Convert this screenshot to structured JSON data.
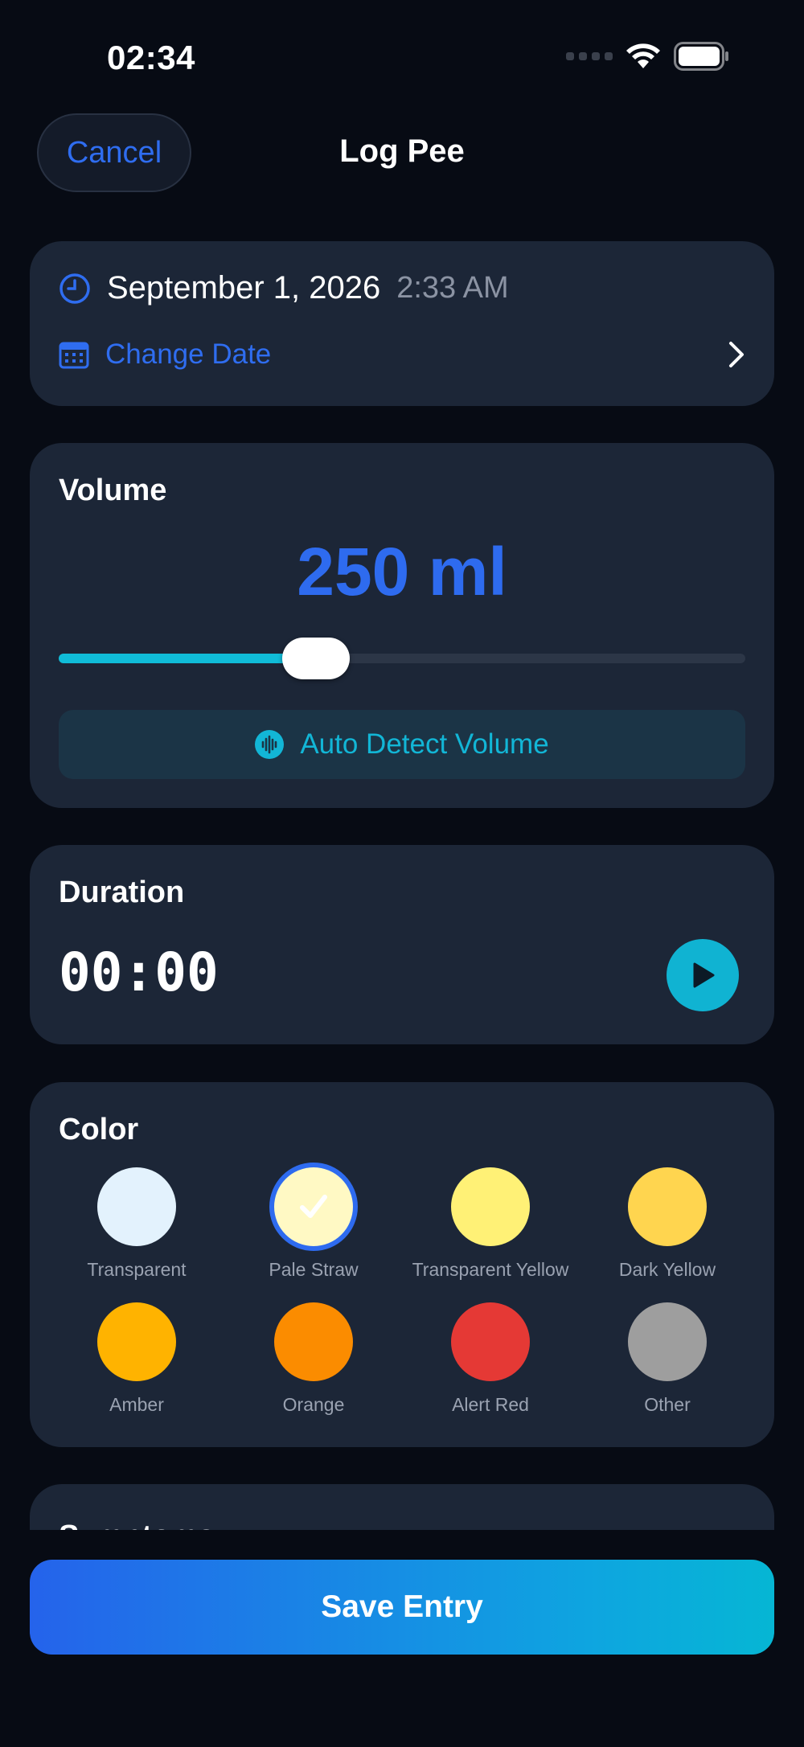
{
  "status_bar": {
    "time": "02:34"
  },
  "nav": {
    "cancel_label": "Cancel",
    "title": "Log Pee"
  },
  "date_card": {
    "date": "September 1, 2026",
    "time": "2:33 AM",
    "change_label": "Change Date"
  },
  "volume": {
    "title": "Volume",
    "value_label": "250 ml",
    "slider_fraction": 0.375,
    "auto_detect_label": "Auto Detect Volume"
  },
  "duration": {
    "title": "Duration",
    "timer": "00:00"
  },
  "color": {
    "title": "Color",
    "selected": "Pale Straw",
    "options": [
      {
        "label": "Transparent",
        "hex": "#e3f2fd"
      },
      {
        "label": "Pale Straw",
        "hex": "#fff9c4"
      },
      {
        "label": "Transparent Yellow",
        "hex": "#fff176"
      },
      {
        "label": "Dark Yellow",
        "hex": "#ffd54f"
      },
      {
        "label": "Amber",
        "hex": "#ffb300"
      },
      {
        "label": "Orange",
        "hex": "#fb8c00"
      },
      {
        "label": "Alert Red",
        "hex": "#e53935"
      },
      {
        "label": "Other",
        "hex": "#9e9e9e"
      }
    ]
  },
  "symptoms": {
    "title": "Symptoms"
  },
  "save_label": "Save Entry",
  "colors": {
    "accent_blue": "#2f6df0",
    "accent_cyan": "#10bcd8",
    "card_bg": "#1c2637",
    "screen_bg": "#070b14"
  }
}
